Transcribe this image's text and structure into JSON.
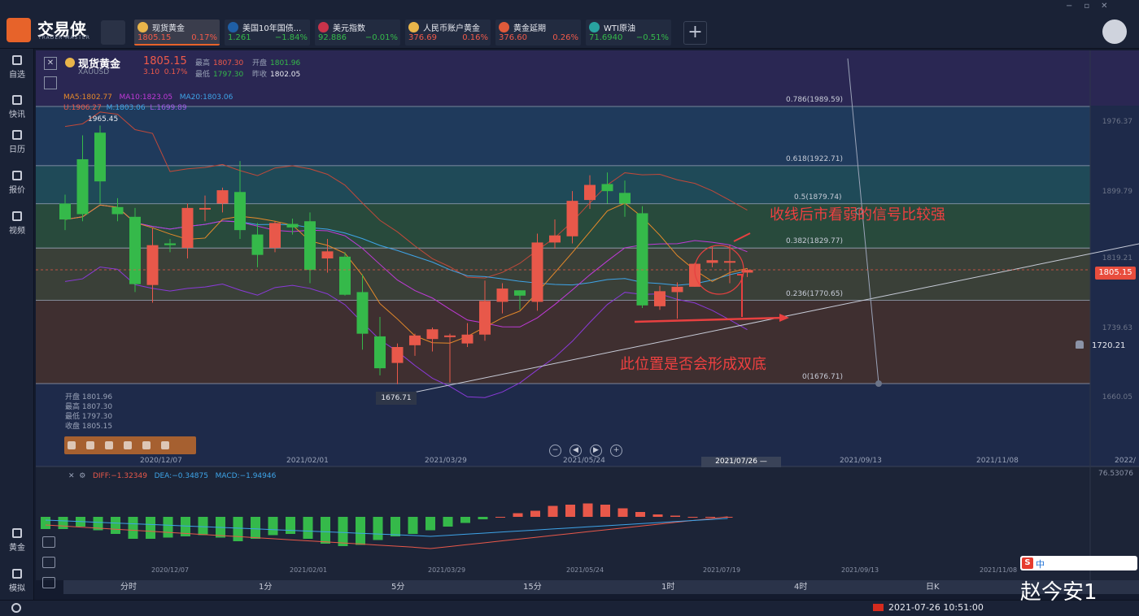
{
  "app": {
    "title": "交易侠",
    "subtitle": "TRADER MASTER"
  },
  "tickers": [
    {
      "name": "现货黄金",
      "price": "1805.15",
      "change": "0.17%",
      "up": true,
      "active": true,
      "icon_color": "#e9b54a"
    },
    {
      "name": "美国10年国债...",
      "price": "1.261",
      "change": "−1.84%",
      "up": false,
      "active": false,
      "icon_color": "#1f5fa6"
    },
    {
      "name": "美元指数",
      "price": "92.886",
      "change": "−0.01%",
      "up": false,
      "active": false,
      "icon_color": "#c8334a"
    },
    {
      "name": "人民币账户黄金",
      "price": "376.69",
      "change": "0.16%",
      "up": true,
      "active": false,
      "icon_color": "#e9b54a"
    },
    {
      "name": "黄金延期",
      "price": "376.60",
      "change": "0.26%",
      "up": true,
      "active": false,
      "icon_color": "#e05a3a"
    },
    {
      "name": "WTI原油",
      "price": "71.6940",
      "change": "−0.51%",
      "up": false,
      "active": false,
      "icon_color": "#29a3a0"
    }
  ],
  "sidebar": {
    "items": [
      {
        "label": "自选",
        "icon": "bookmark-icon"
      },
      {
        "label": "快讯",
        "icon": "news-icon"
      },
      {
        "label": "日历",
        "icon": "calendar-icon"
      },
      {
        "label": "报价",
        "icon": "trend-icon"
      },
      {
        "label": "视频",
        "icon": "play-icon"
      },
      {
        "label": "黄金",
        "icon": "gold-icon"
      },
      {
        "label": "模拟",
        "icon": "wallet-icon"
      }
    ]
  },
  "symbol": {
    "name": "现货黄金",
    "code": "XAUUSD",
    "price": "1805.15",
    "change": "3.10",
    "change_pct": "0.17%",
    "high_label": "最高",
    "high": "1807.30",
    "open_label": "开盘",
    "open": "1801.96",
    "low_label": "最低",
    "low": "1797.30",
    "prev_label": "昨收",
    "prev": "1802.05"
  },
  "indicators": {
    "ma5": "MA5:1802.77",
    "ma10": "MA10:1823.05",
    "ma20": "MA20:1803.06",
    "bb_u": "U:1906.27",
    "bb_m": "M:1803.06",
    "bb_l": "L:1699.89"
  },
  "hi_label": "1965.45",
  "low_marker": "1676.71",
  "fib_levels": [
    {
      "label": "0.786(1989.59)",
      "value": 1989.59
    },
    {
      "label": "0.618(1922.71)",
      "value": 1922.71
    },
    {
      "label": "0.5(1879.74)",
      "value": 1879.74
    },
    {
      "label": "0.382(1829.77)",
      "value": 1829.77
    },
    {
      "label": "0.236(1770.65)",
      "value": 1770.65
    },
    {
      "label": "0(1676.71)",
      "value": 1676.71
    }
  ],
  "y_axis": [
    "1976.37",
    "1899.79",
    "1819.21",
    "1739.63",
    "1660.05"
  ],
  "current_price_tag": "1805.15",
  "alert_price": "1720.21",
  "x_axis": [
    "2020/12/07",
    "2021/02/01",
    "2021/03/29",
    "2021/05/24",
    "2021/07/26 —",
    "2021/09/13",
    "2021/11/08",
    "2022/"
  ],
  "x_axis_macd": [
    "2020/12/07",
    "2021/02/01",
    "2021/03/29",
    "2021/05/24",
    "2021/07/19",
    "2021/09/13",
    "2021/11/08"
  ],
  "info_box": {
    "open": "开盘 1801.96",
    "high": "最高 1807.30",
    "low": "最低 1797.30",
    "close": "收盘 1805.15"
  },
  "annotations": {
    "top": "收线后市看弱的信号比较强",
    "bottom": "此位置是否会形成双底"
  },
  "macd": {
    "diff": "DIFF:−1.32349",
    "dea": "DEA:−0.34875",
    "macd": "MACD:−1.94946",
    "max": "76.53076"
  },
  "timeframes": [
    "分时",
    "1分",
    "5分",
    "15分",
    "1时",
    "4时",
    "日K"
  ],
  "status": {
    "datetime": "2021-07-26 10:51:00"
  },
  "watermark": "赵今安1",
  "ime": {
    "lang": "中"
  },
  "colors": {
    "up": "#e8584a",
    "down": "#35b94a",
    "accent": "#e7632a",
    "ma5": "#e78a2a",
    "ma10": "#c03ad8",
    "ma20": "#3ea4e8"
  },
  "chart_data": {
    "type": "candlestick",
    "candles": [
      {
        "o": 1880,
        "h": 1890,
        "l": 1850,
        "c": 1862
      },
      {
        "o": 1930,
        "h": 1957,
        "l": 1860,
        "c": 1868
      },
      {
        "o": 1960,
        "h": 1968,
        "l": 1880,
        "c": 1905
      },
      {
        "o": 1876,
        "h": 1886,
        "l": 1860,
        "c": 1868
      },
      {
        "o": 1865,
        "h": 1875,
        "l": 1780,
        "c": 1789
      },
      {
        "o": 1788,
        "h": 1852,
        "l": 1768,
        "c": 1833
      },
      {
        "o": 1835,
        "h": 1840,
        "l": 1825,
        "c": 1833
      },
      {
        "o": 1830,
        "h": 1880,
        "l": 1818,
        "c": 1875
      },
      {
        "o": 1874,
        "h": 1889,
        "l": 1860,
        "c": 1875
      },
      {
        "o": 1880,
        "h": 1898,
        "l": 1870,
        "c": 1895
      },
      {
        "o": 1893,
        "h": 1928,
        "l": 1840,
        "c": 1850
      },
      {
        "o": 1845,
        "h": 1858,
        "l": 1808,
        "c": 1822
      },
      {
        "o": 1830,
        "h": 1860,
        "l": 1825,
        "c": 1858
      },
      {
        "o": 1857,
        "h": 1863,
        "l": 1845,
        "c": 1853
      },
      {
        "o": 1860,
        "h": 1870,
        "l": 1790,
        "c": 1805
      },
      {
        "o": 1818,
        "h": 1840,
        "l": 1802,
        "c": 1826
      },
      {
        "o": 1820,
        "h": 1825,
        "l": 1776,
        "c": 1777
      },
      {
        "o": 1780,
        "h": 1800,
        "l": 1715,
        "c": 1733
      },
      {
        "o": 1730,
        "h": 1752,
        "l": 1686,
        "c": 1694
      },
      {
        "o": 1700,
        "h": 1722,
        "l": 1676,
        "c": 1718
      },
      {
        "o": 1720,
        "h": 1733,
        "l": 1708,
        "c": 1731
      },
      {
        "o": 1727,
        "h": 1740,
        "l": 1713,
        "c": 1738
      },
      {
        "o": 1730,
        "h": 1733,
        "l": 1678,
        "c": 1731
      },
      {
        "o": 1722,
        "h": 1745,
        "l": 1718,
        "c": 1732
      },
      {
        "o": 1732,
        "h": 1793,
        "l": 1725,
        "c": 1770
      },
      {
        "o": 1769,
        "h": 1790,
        "l": 1756,
        "c": 1784
      },
      {
        "o": 1782,
        "h": 1782,
        "l": 1760,
        "c": 1776
      },
      {
        "o": 1769,
        "h": 1846,
        "l": 1759,
        "c": 1836
      },
      {
        "o": 1836,
        "h": 1862,
        "l": 1829,
        "c": 1844
      },
      {
        "o": 1843,
        "h": 1894,
        "l": 1835,
        "c": 1883
      },
      {
        "o": 1884,
        "h": 1912,
        "l": 1874,
        "c": 1901
      },
      {
        "o": 1902,
        "h": 1915,
        "l": 1880,
        "c": 1894
      },
      {
        "o": 1892,
        "h": 1906,
        "l": 1865,
        "c": 1880
      },
      {
        "o": 1869,
        "h": 1877,
        "l": 1762,
        "c": 1765
      },
      {
        "o": 1764,
        "h": 1787,
        "l": 1760,
        "c": 1781
      },
      {
        "o": 1780,
        "h": 1791,
        "l": 1750,
        "c": 1786
      },
      {
        "o": 1786,
        "h": 1813,
        "l": 1786,
        "c": 1812
      },
      {
        "o": 1813,
        "h": 1831,
        "l": 1808,
        "c": 1816
      },
      {
        "o": 1815,
        "h": 1833,
        "l": 1790,
        "c": 1815
      },
      {
        "o": 1802,
        "h": 1807,
        "l": 1797,
        "c": 1805
      }
    ],
    "macd_hist": [
      -10,
      -10,
      -8,
      -11,
      -14,
      -18,
      -18,
      -17,
      -16,
      -15,
      -17,
      -20,
      -18,
      -15,
      -14,
      -18,
      -22,
      -24,
      -23,
      -19,
      -16,
      -14,
      -11,
      -8,
      -5,
      -2,
      0,
      3,
      5,
      9,
      10,
      11,
      10,
      7,
      4,
      2,
      1,
      0,
      0,
      0
    ]
  }
}
